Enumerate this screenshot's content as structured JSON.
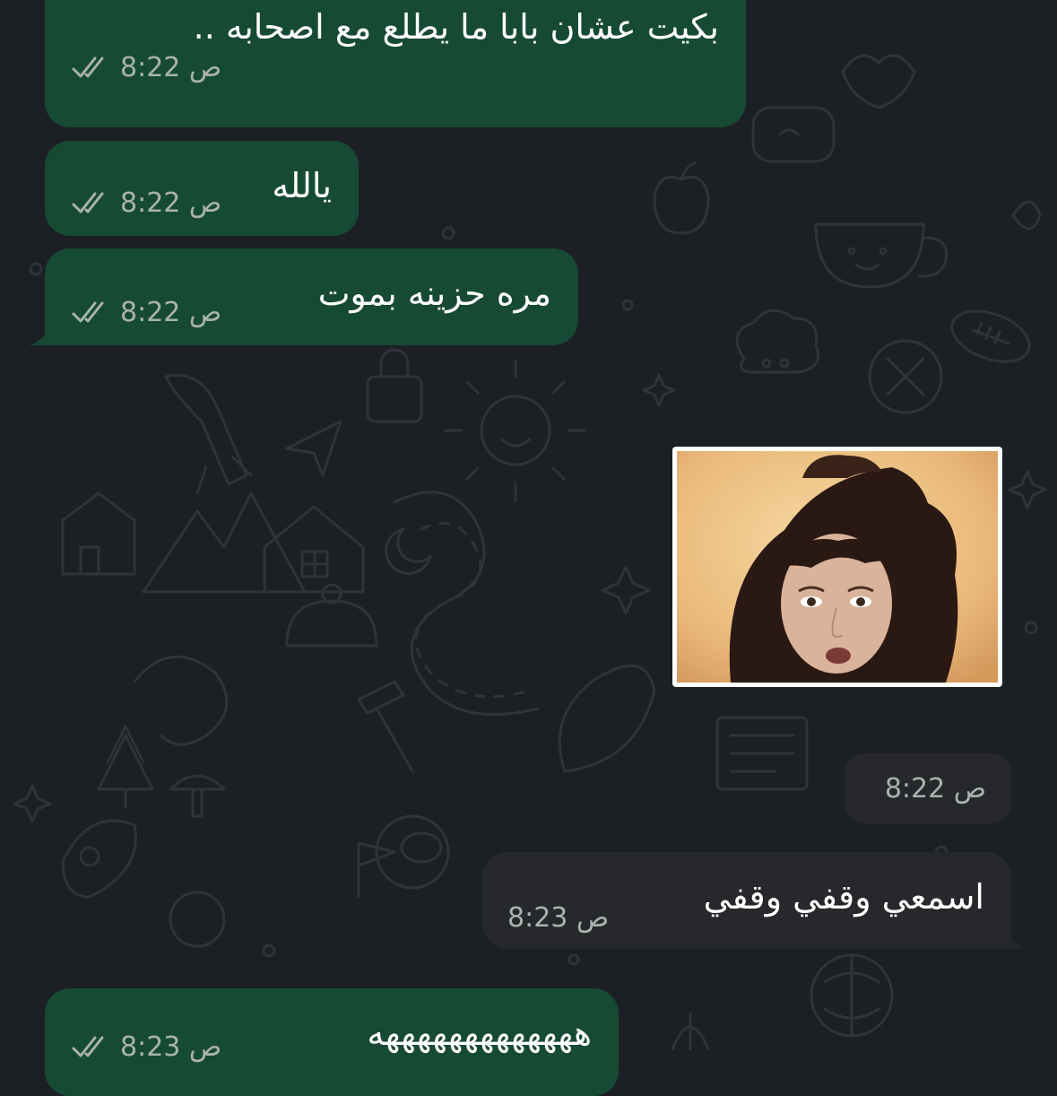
{
  "colors": {
    "background": "#1c1f24",
    "outgoing_bubble": "#174a34",
    "incoming_bubble": "#26282b",
    "meta_text": "#a9b3ad"
  },
  "messages": [
    {
      "direction": "outgoing",
      "text": "بكيت عشان بابا ما يطلع مع اصحابه ..",
      "time": "8:22 ص",
      "status": "read"
    },
    {
      "direction": "outgoing",
      "text": "يالله",
      "time": "8:22 ص",
      "status": "read"
    },
    {
      "direction": "outgoing",
      "text": "مره حزينه بموت",
      "time": "8:22 ص",
      "status": "read"
    },
    {
      "direction": "incoming",
      "type": "image",
      "time": "8:22 ص"
    },
    {
      "direction": "incoming",
      "text": "اسمعي وقفي وقفي",
      "time": "8:23 ص"
    },
    {
      "direction": "outgoing",
      "text": "هههههههههههههه",
      "time": "8:23 ص",
      "status": "read"
    }
  ],
  "icons": {
    "read_receipt": "double-check-icon",
    "photo": "sticker-photo"
  }
}
